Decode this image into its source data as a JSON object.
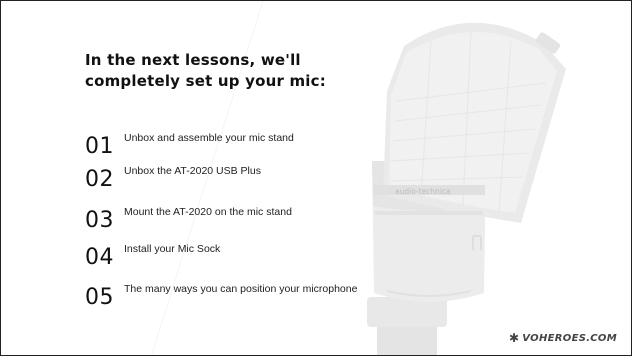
{
  "slide": {
    "heading": "In the next lessons, we'll completely set up your mic:",
    "lessons": [
      {
        "number": "01",
        "text": "Unbox and assemble your mic stand"
      },
      {
        "number": "02",
        "text": "Unbox the AT-2020 USB Plus"
      },
      {
        "number": "03",
        "text": "Mount the AT-2020 on the mic stand"
      },
      {
        "number": "04",
        "text": "Install your Mic Sock"
      },
      {
        "number": "05",
        "text": "The many ways you can position your microphone"
      }
    ],
    "mic_brand_text": "audio-technica",
    "brand": {
      "icon": "star-icon",
      "star": "✱",
      "text": "VOHEROES.COM"
    }
  },
  "colors": {
    "background": "#ffffff",
    "text": "#111111",
    "mic_body": "#e4e4e4",
    "mic_grille": "#d9d9d9",
    "border": "#222222"
  }
}
